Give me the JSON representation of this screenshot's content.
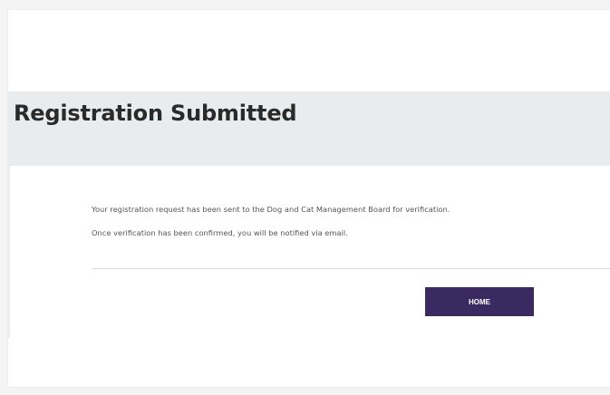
{
  "page": {
    "title": "Registration Submitted",
    "message_line_1": "Your registration request has been sent to the Dog and Cat Management Board for verification.",
    "message_line_2": "Once verification has been confirmed, you will be notified via email.",
    "home_button_label": "HOME"
  },
  "colors": {
    "title_band": "#e8ecef",
    "button": "#3b2a62",
    "button_text": "#ffffff"
  }
}
